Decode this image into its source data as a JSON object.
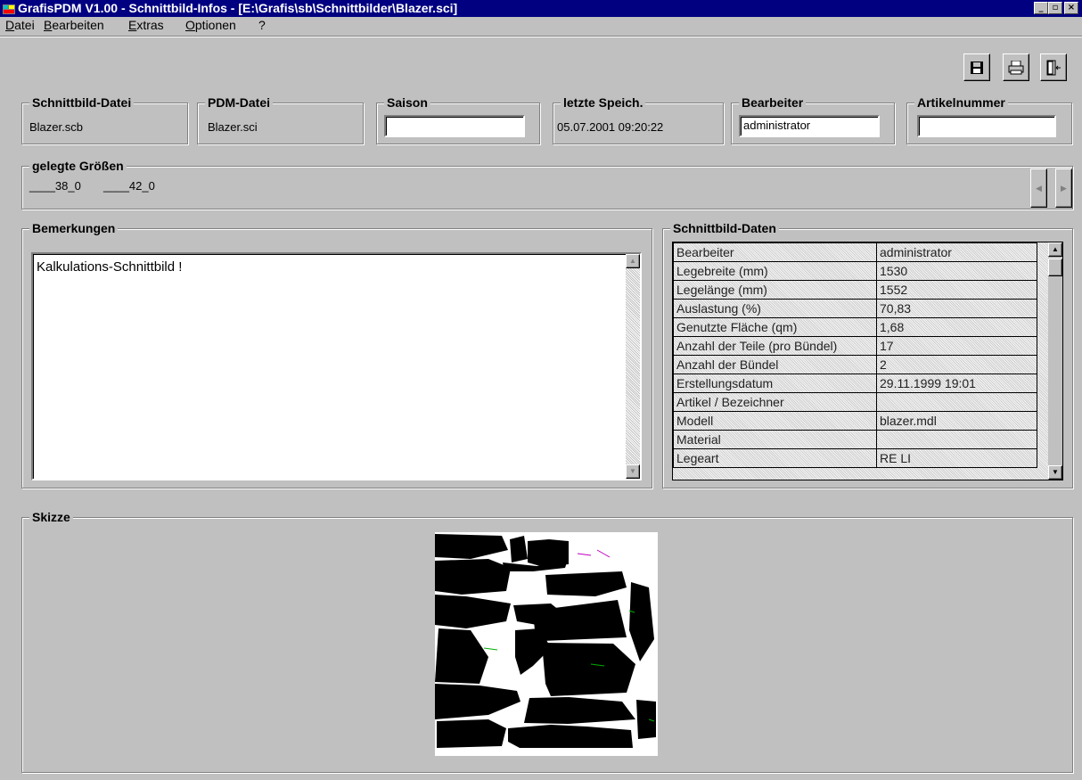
{
  "window": {
    "title": "GrafisPDM V1.00  -  Schnittbild-Infos - [E:\\Grafis\\sb\\Schnittbilder\\Blazer.sci]",
    "minimize": "_",
    "maximize": "▫",
    "close": "×"
  },
  "menu": [
    "Datei",
    "Bearbeiten",
    "Extras",
    "Optionen",
    "?"
  ],
  "toolbar": {
    "save_icon": "save-icon",
    "print_icon": "printer-icon",
    "exit_icon": "exit-door-icon"
  },
  "fields": {
    "schnittbild_datei": {
      "label": "Schnittbild-Datei",
      "value": "Blazer.scb"
    },
    "pdm_datei": {
      "label": "PDM-Datei",
      "value": "Blazer.sci"
    },
    "saison": {
      "label": "Saison",
      "value": ""
    },
    "letzte_speich": {
      "label": "letzte Speich.",
      "value": "05.07.2001  09:20:22"
    },
    "bearbeiter": {
      "label": "Bearbeiter",
      "value": "administrator"
    },
    "artikelnummer": {
      "label": "Artikelnummer",
      "value": ""
    }
  },
  "sizes": {
    "label": "gelegte Größen",
    "items": [
      "____38_0",
      "____42_0"
    ]
  },
  "remarks": {
    "label": "Bemerkungen",
    "text": "Kalkulations-Schnittbild !"
  },
  "data_grid": {
    "label": "Schnittbild-Daten",
    "rows": [
      [
        "Bearbeiter",
        "administrator"
      ],
      [
        "Legebreite (mm)",
        "1530"
      ],
      [
        "Legelänge (mm)",
        "1552"
      ],
      [
        "Auslastung (%)",
        "70,83"
      ],
      [
        "Genutzte Fläche (qm)",
        "1,68"
      ],
      [
        "Anzahl der Teile (pro Bündel)",
        "17"
      ],
      [
        "Anzahl der Bündel",
        "2"
      ],
      [
        "Erstellungsdatum",
        "29.11.1999  19:01"
      ],
      [
        "Artikel / Bezeichner",
        ""
      ],
      [
        "Modell",
        "blazer.mdl"
      ],
      [
        "Material",
        ""
      ],
      [
        "Legeart",
        "RE  LI"
      ]
    ]
  },
  "sketch": {
    "label": "Skizze"
  },
  "colors": {
    "titlebar": "#000080",
    "face": "#c0c0c0"
  }
}
